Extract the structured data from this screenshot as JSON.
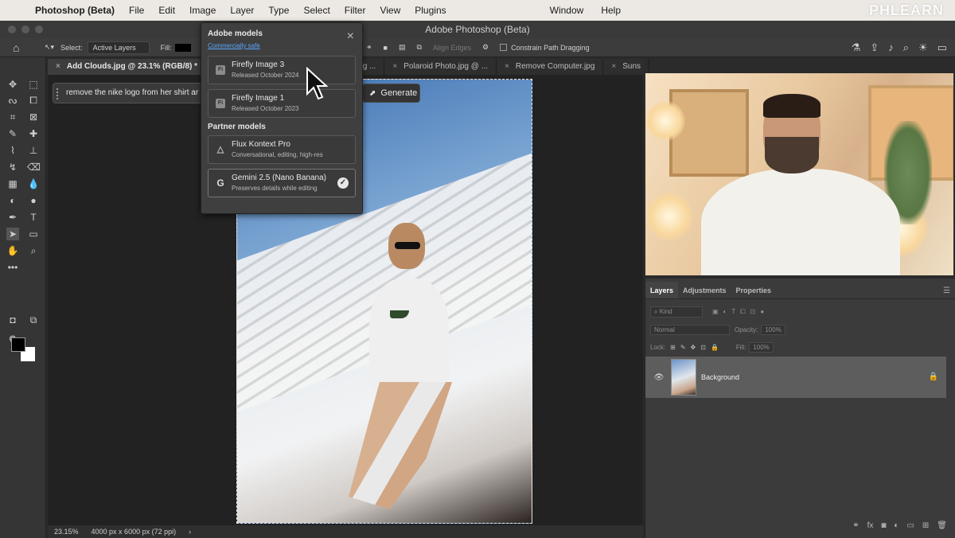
{
  "menubar": {
    "app_name": "Photoshop (Beta)",
    "items": [
      "File",
      "Edit",
      "Image",
      "Layer",
      "Type",
      "Select",
      "Filter",
      "View",
      "Plugins"
    ],
    "right_items": [
      "Window",
      "Help"
    ],
    "watermark": "PHLEARN"
  },
  "window": {
    "title": "Adobe Photoshop (Beta)"
  },
  "options": {
    "select_label": "Select:",
    "select_value": "Active Layers",
    "fill_label": "Fill:",
    "align_edges": "Align Edges",
    "constrain": "Constrain Path Dragging"
  },
  "tabs": [
    {
      "label": "Add Clouds.jpg @ 23.1% (RGB/8) *"
    },
    {
      "label": "ng.jpg ..."
    },
    {
      "label": "Polaroid Photo.jpg @ ..."
    },
    {
      "label": "Remove Computer.jpg"
    },
    {
      "label": "Suns"
    }
  ],
  "prompt": {
    "text": "remove the nike logo from her shirt ar"
  },
  "generate": {
    "label": "Generate"
  },
  "dropdown": {
    "adobe_heading": "Adobe models",
    "commercial_link": "Commercially safe",
    "partner_heading": "Partner models",
    "models": [
      {
        "name": "Firefly Image 3",
        "sub": "Released October 2024",
        "icon": "Fi"
      },
      {
        "name": "Firefly Image 1",
        "sub": "Released October 2023",
        "icon": "Fi"
      }
    ],
    "partners": [
      {
        "name": "Flux Kontext Pro",
        "sub": "Conversational, editing, high-res"
      },
      {
        "name": "Gemini 2.5 (Nano Banana)",
        "sub": "Preserves details while editing"
      }
    ]
  },
  "layers_panel": {
    "tabs": [
      "Layers",
      "Adjustments",
      "Properties"
    ],
    "kind": "Kind",
    "blend": "Normal",
    "opacity_label": "Opacity:",
    "opacity_value": "100%",
    "lock_label": "Lock:",
    "fill_label": "Fill:",
    "fill_value": "100%",
    "layer_name": "Background"
  },
  "status": {
    "zoom": "23.15%",
    "doc": "4000 px x 6000 px (72 ppi)"
  }
}
